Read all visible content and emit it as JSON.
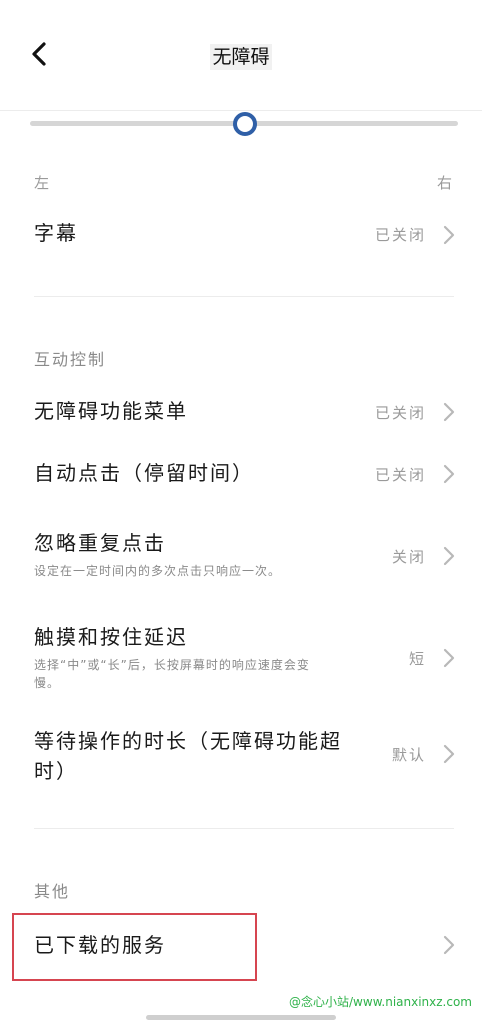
{
  "header": {
    "title": "无障碍"
  },
  "slider": {
    "value": 0.5,
    "left_label": "左",
    "right_label": "右"
  },
  "subtitles_row": {
    "title": "字幕",
    "value": "已关闭"
  },
  "interaction_section": {
    "header": "互动控制",
    "items": [
      {
        "title": "无障碍功能菜单",
        "value": "已关闭"
      },
      {
        "title": "自动点击（停留时间）",
        "value": "已关闭"
      },
      {
        "title": "忽略重复点击",
        "subtitle": "设定在一定时间内的多次点击只响应一次。",
        "value": "关闭"
      },
      {
        "title": "触摸和按住延迟",
        "subtitle_line1": "选择“中”或“长”后，长按屏幕时的响应速度会变",
        "subtitle_line2": "慢。",
        "value": "短"
      },
      {
        "title_line1": "等待操作的时长（无障碍功能超",
        "title_line2": "时）",
        "value": "默认"
      }
    ]
  },
  "other_section": {
    "header": "其他",
    "items": [
      {
        "title": "已下载的服务"
      }
    ]
  },
  "watermark": "@念心小站/www.nianxinxz.com",
  "colors": {
    "slider_thumb": "#2f5fa7",
    "highlight_border": "#d64550",
    "watermark": "#2fb24a"
  }
}
